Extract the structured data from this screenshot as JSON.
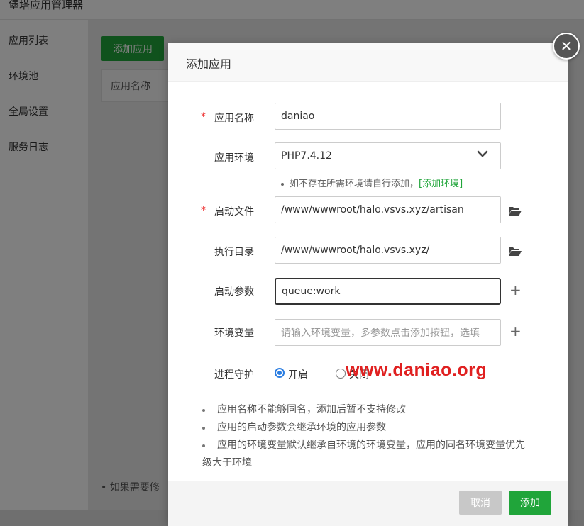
{
  "app": {
    "title": "堡塔应用管理器",
    "sidebar": [
      {
        "label": "应用列表"
      },
      {
        "label": "环境池"
      },
      {
        "label": "全局设置"
      },
      {
        "label": "服务日志"
      }
    ],
    "add_button": "添加应用",
    "table_header_name": "应用名称",
    "bottom_tip": "• 如果需要修"
  },
  "modal": {
    "title": "添加应用",
    "close_glyph": "✕",
    "fields": {
      "name": {
        "label": "应用名称",
        "value": "daniao",
        "required": true
      },
      "env": {
        "label": "应用环境",
        "value": "PHP7.4.12"
      },
      "env_hint": {
        "text": "如不存在所需环境请自行添加，",
        "link": "[添加环境]"
      },
      "start_file": {
        "label": "启动文件",
        "value": "/www/wwwroot/halo.vsvs.xyz/artisan",
        "required": true
      },
      "exec_dir": {
        "label": "执行目录",
        "value": "/www/wwwroot/halo.vsvs.xyz/"
      },
      "start_args": {
        "label": "启动参数",
        "value": "queue:work"
      },
      "env_vars": {
        "label": "环境变量",
        "placeholder": "请输入环境变量，多参数点击添加按钮，选填"
      },
      "daemon": {
        "label": "进程守护",
        "options": [
          {
            "label": "开启",
            "checked": true
          },
          {
            "label": "关闭",
            "checked": false
          }
        ]
      }
    },
    "required_mark": "*",
    "plus_glyph": "+",
    "notes": [
      "应用名称不能够同名，添加后暂不支持修改",
      "应用的启动参数会继承环境的应用参数",
      "应用的环境变量默认继承自环境的环境变量，应用的同名环境变量优先",
      "级大于环境"
    ],
    "cancel": "取消",
    "confirm": "添加"
  },
  "watermark": "www.daniao.org",
  "colors": {
    "brand_green": "#20a53a",
    "required_red": "#e33333",
    "radio_blue": "#2a7de1",
    "watermark_red": "#e02020"
  }
}
